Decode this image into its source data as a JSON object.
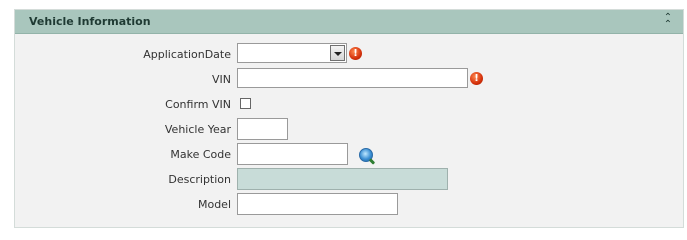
{
  "section": {
    "title": "Vehicle Information",
    "collapse_icon": "double-chevron-up-icon"
  },
  "fields": {
    "application_date": {
      "label": "ApplicationDate",
      "value": ""
    },
    "vin": {
      "label": "VIN",
      "value": ""
    },
    "confirm_vin": {
      "label": "Confirm VIN",
      "checked": false
    },
    "vehicle_year": {
      "label": "Vehicle Year",
      "value": ""
    },
    "make_code": {
      "label": "Make Code",
      "value": ""
    },
    "description": {
      "label": "Description",
      "value": ""
    },
    "model": {
      "label": "Model",
      "value": ""
    }
  },
  "required_marker": "!",
  "colors": {
    "header_bg": "#a9c6bd",
    "panel_bg": "#f2f2f2",
    "readonly_bg": "#c8dcd8",
    "required_icon": "#d4300b"
  }
}
